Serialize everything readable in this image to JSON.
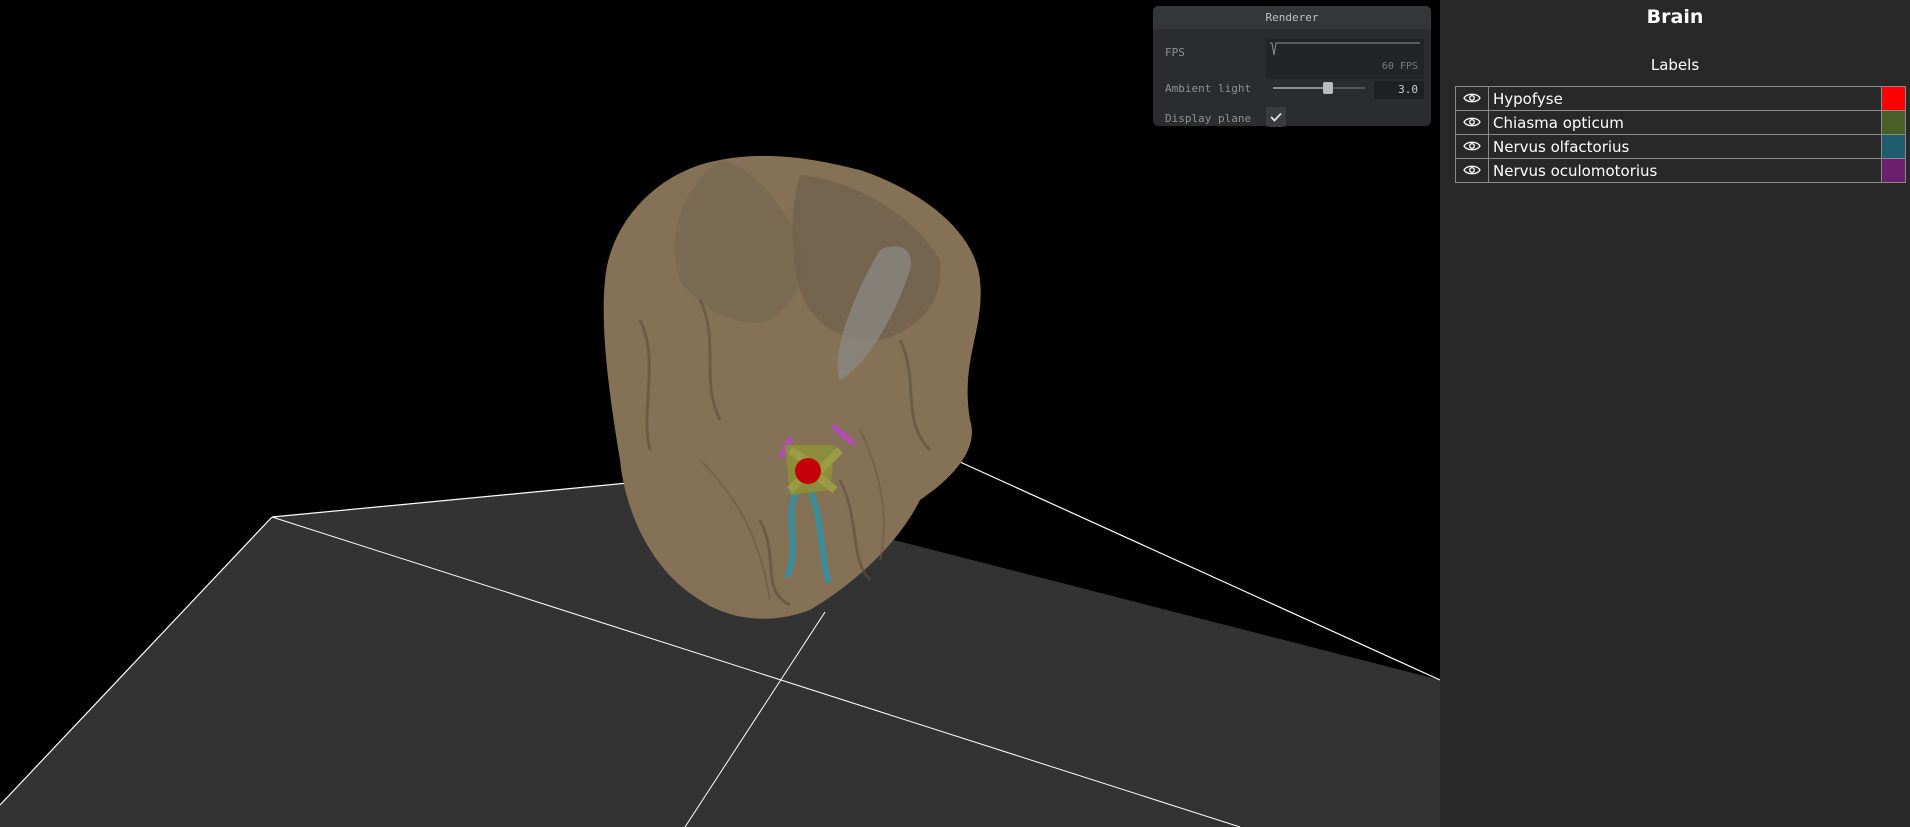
{
  "renderer": {
    "title": "Renderer",
    "fps_label": "FPS",
    "fps_value": "60",
    "fps_unit": "FPS",
    "ambient_label": "Ambient light",
    "ambient_value": "3.0",
    "ambient_fraction": 0.6,
    "plane_label": "Display plane",
    "plane_checked": true
  },
  "panel": {
    "title": "Brain",
    "subtitle": "Labels",
    "labels": [
      {
        "name": "Hypofyse",
        "color": "#ff0000",
        "icon": "eye-icon"
      },
      {
        "name": "Chiasma opticum",
        "color": "#4b5e27",
        "icon": "eye-icon"
      },
      {
        "name": "Nervus olfactorius",
        "color": "#1f5c6e",
        "icon": "eye-icon"
      },
      {
        "name": "Nervus oculomotorius",
        "color": "#6b1f6e",
        "icon": "eye-icon"
      }
    ]
  },
  "scene": {
    "background": "#000000",
    "plane_color": "#333333",
    "brain_color": "#8a7659"
  }
}
